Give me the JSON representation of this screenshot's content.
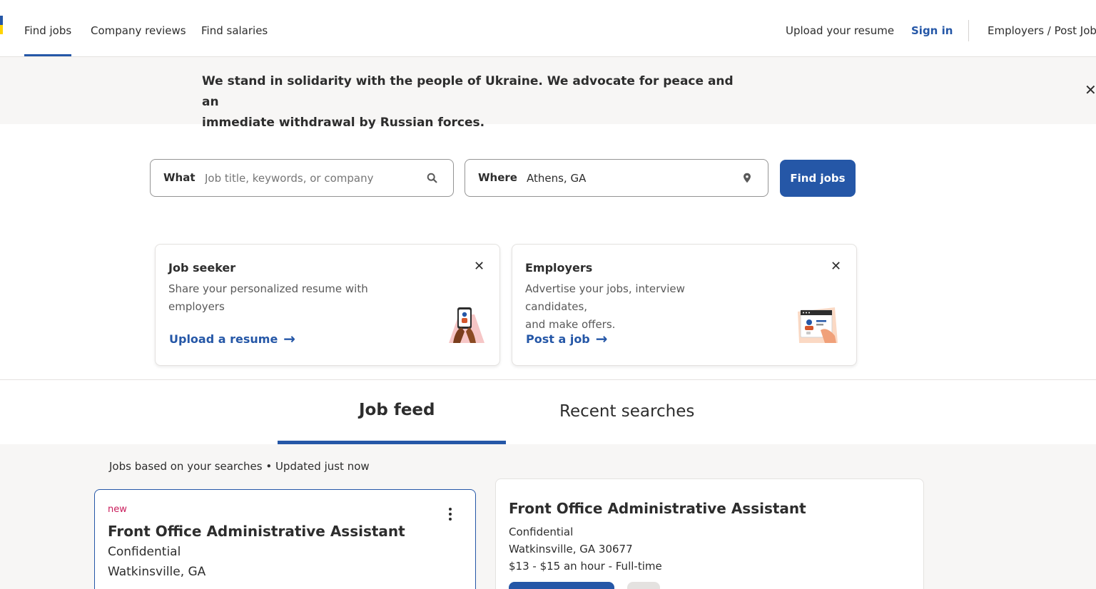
{
  "header": {
    "nav": [
      "Find jobs",
      "Company reviews",
      "Find salaries"
    ],
    "upload_resume": "Upload your resume",
    "sign_in": "Sign in",
    "employers": "Employers / Post Job"
  },
  "banner": {
    "line1": "We stand in solidarity with the people of Ukraine. We advocate for peace and an",
    "line2": "immediate withdrawal by Russian forces.",
    "close_icon": "close-icon"
  },
  "search": {
    "what_label": "What",
    "what_placeholder": "Job title, keywords, or company",
    "where_label": "Where",
    "where_value": "Athens, GA",
    "button": "Find jobs"
  },
  "promos": [
    {
      "title": "Job seeker",
      "desc_line1": "Share your personalized resume with",
      "desc_line2": "employers",
      "link": "Upload a resume"
    },
    {
      "title": "Employers",
      "desc_line1": "Advertise your jobs, interview candidates,",
      "desc_line2": "and make offers.",
      "link": "Post a job"
    }
  ],
  "tabs": {
    "job_feed": "Job feed",
    "recent_searches": "Recent searches"
  },
  "feed": {
    "meta": "Jobs based on your searches • Updated just now",
    "job_card": {
      "tag": "new",
      "title": "Front Office Administrative Assistant",
      "company": "Confidential",
      "location": "Watkinsville, GA"
    },
    "detail": {
      "title": "Front Office Administrative Assistant",
      "company": "Confidential",
      "location": "Watkinsville, GA 30677",
      "pay": "$13 - $15 an hour  - Full-time"
    }
  },
  "colors": {
    "accent": "#2557a7",
    "new_tag": "#c91b5a",
    "banner_bg": "#f7f6f5"
  }
}
